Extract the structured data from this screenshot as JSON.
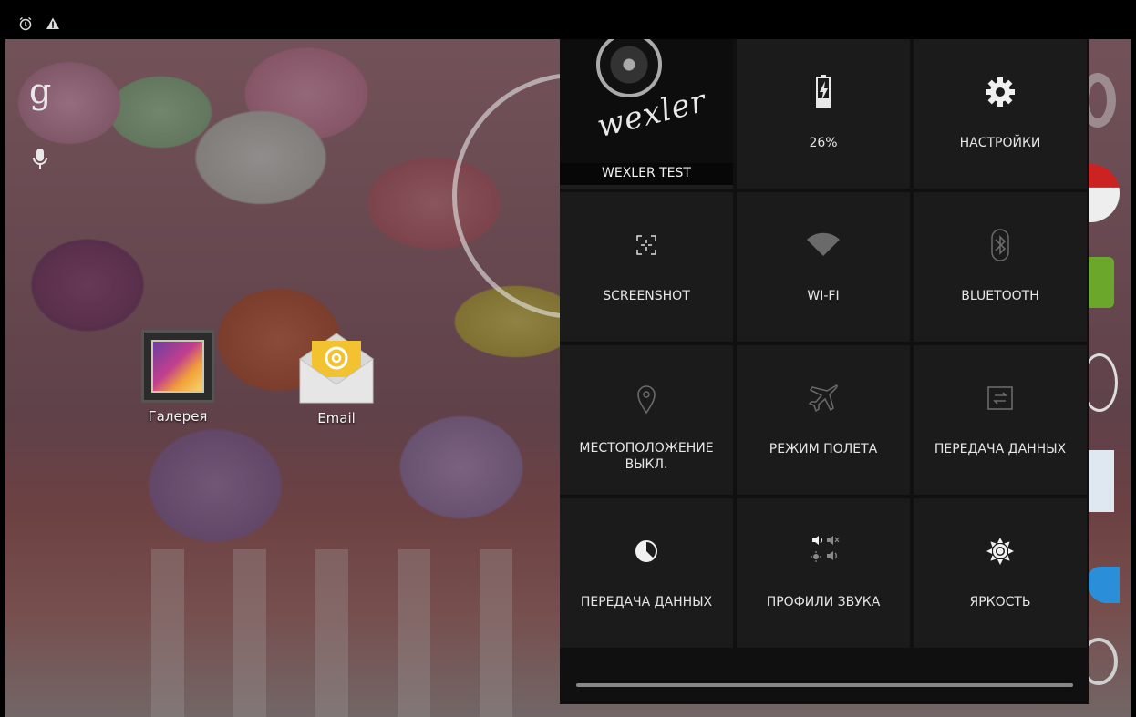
{
  "status_bar": {
    "icons": [
      "alarm-icon",
      "warning-icon"
    ]
  },
  "home": {
    "apps": [
      {
        "label": "Галерея",
        "icon": "gallery-icon"
      },
      {
        "label": "Email",
        "icon": "email-icon"
      }
    ]
  },
  "quick_settings": {
    "user": {
      "name": "WEXLER TEST",
      "photo_brand": "wexler"
    },
    "battery": {
      "label": "26%",
      "icon": "battery-charging-icon"
    },
    "settings": {
      "label": "НАСТРОЙКИ",
      "icon": "gear-icon"
    },
    "screenshot": {
      "label": "SCREENSHOT",
      "icon": "screenshot-icon"
    },
    "wifi": {
      "label": "WI-FI",
      "icon": "wifi-icon"
    },
    "bluetooth": {
      "label": "BLUETOOTH",
      "icon": "bluetooth-icon"
    },
    "location": {
      "label": "МЕСТОПОЛОЖЕНИЕ\nВЫКЛ.",
      "icon": "location-icon"
    },
    "airplane": {
      "label": "РЕЖИМ ПОЛЕТА",
      "icon": "airplane-icon"
    },
    "data_transfer": {
      "label": "ПЕРЕДАЧА ДАННЫХ",
      "icon": "data-transfer-icon"
    },
    "data_usage": {
      "label": "ПЕРЕДАЧА ДАННЫХ",
      "icon": "data-usage-icon"
    },
    "sound_profiles": {
      "label": "ПРОФИЛИ ЗВУКА",
      "icon": "sound-profiles-icon"
    },
    "brightness": {
      "label": "ЯРКОСТЬ",
      "icon": "brightness-icon"
    }
  },
  "colors": {
    "panel_bg": "#101010",
    "tile_bg": "#1b1b1b",
    "text": "#e6e6e6",
    "status_bar": "#000000"
  }
}
